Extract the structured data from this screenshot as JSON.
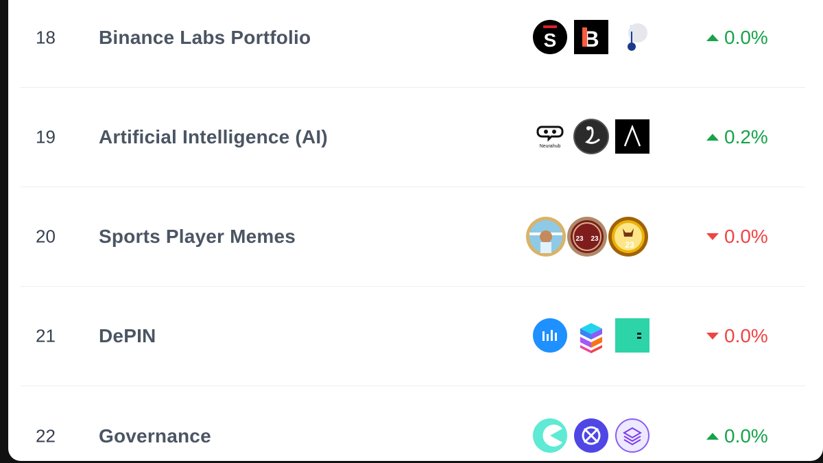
{
  "rows": [
    {
      "rank": "18",
      "name": "Binance Labs Portfolio",
      "change": "0.0%",
      "direction": "up",
      "icons": [
        "s-token-icon",
        "b-token-icon",
        "thermometer-token-icon"
      ]
    },
    {
      "rank": "19",
      "name": "Artificial Intelligence (AI)",
      "change": "0.2%",
      "direction": "up",
      "icons": [
        "neurahub-icon",
        "swan-token-icon",
        "lambda-token-icon"
      ],
      "icon_label": "Neurahub"
    },
    {
      "rank": "20",
      "name": "Sports Player Memes",
      "change": "0.0%",
      "direction": "down",
      "icons": [
        "football-player-coin-icon",
        "basketball-23-coin-icon",
        "goat-23-coin-icon"
      ]
    },
    {
      "rank": "21",
      "name": "DePIN",
      "change": "0.0%",
      "direction": "down",
      "icons": [
        "bar-chart-token-icon",
        "stacked-blocks-token-icon",
        "crescent-token-icon"
      ]
    },
    {
      "rank": "22",
      "name": "Governance",
      "change": "0.0%",
      "direction": "up",
      "icons": [
        "pacman-token-icon",
        "crossed-circle-token-icon",
        "layers-token-icon"
      ]
    }
  ],
  "colors": {
    "up": "#16a34a",
    "down": "#ef4444",
    "name": "#4b5563"
  }
}
